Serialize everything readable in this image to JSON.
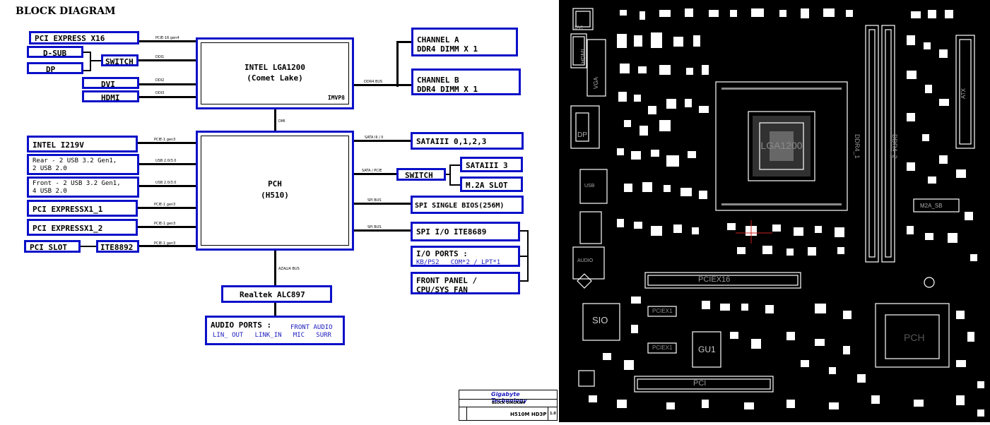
{
  "title": "BLOCK DIAGRAM",
  "cpu": {
    "line1": "INTEL LGA1200",
    "line2": "(Comet Lake)",
    "vr": "IMVP8"
  },
  "pch": {
    "line1": "PCH",
    "line2": "(H510)"
  },
  "left_top": {
    "pcie_x16": "PCI EXPRESS X16",
    "dsub": "D-SUB",
    "dp": "DP",
    "switch": "SWITCH",
    "dvi": "DVI",
    "hdmi": "HDMI"
  },
  "left_bottom": {
    "lan": "INTEL I219V",
    "rear_usb": "Rear - 2 USB 3.2 Gen1,\n2 USB 2.0",
    "front_usb": "Front - 2 USB 3.2 Gen1,\n4 USB 2.0",
    "pcie_x1_1": "PCI EXPRESSX1_1",
    "pcie_x1_2": "PCI EXPRESSX1_2",
    "pci_slot": "PCI SLOT",
    "ite8892": "ITE8892"
  },
  "right": {
    "ch_a_1": "CHANNEL A",
    "ch_a_2": "DDR4 DIMM X 1",
    "ch_b_1": "CHANNEL B",
    "ch_b_2": "DDR4 DIMM X 1",
    "sata": "SATAIII 0,1,2,3",
    "switch": "SWITCH",
    "sata3": "SATAIII 3",
    "m2a": "M.2A SLOT",
    "spi_bios": "SPI SINGLE BIOS(256M)",
    "spi_io": "SPI I/O ITE8689",
    "io_ports": "I/O PORTS :",
    "io_ports_sub": "KB/PS2   COM*2 / LPT*1",
    "front_panel_1": "FRONT PANEL /",
    "front_panel_2": "CPU/SYS FAN"
  },
  "audio": {
    "codec": "Realtek ALC897",
    "ports_label": "AUDIO PORTS :",
    "front_audio": "FRONT AUDIO",
    "line1": "LIN_ OUT   LINK_IN   MIC   SURR"
  },
  "bus_labels": {
    "pcie16": "PCIE-16 gen4",
    "ddi1": "DDI1",
    "ddi2": "DDI2",
    "ddi3": "DDI3",
    "ddr4": "DDR4 BUS",
    "dmi": "DMI",
    "lan_bus": "PCIE-1 gen3",
    "usb_rear": "USB 2.0/3.0",
    "usb_front": "USB 2.0/3.0",
    "pcie1_1": "PCIE-1 gen3",
    "pcie1_2": "PCIE-1 gen3",
    "pcie1_ite": "PCIE-1 gen3",
    "sata_bus": "SATA III / II",
    "sata_pcie": "SATA / PCIE",
    "spi1": "SPI BUS",
    "spi2": "SPI BUS",
    "azalia": "AZALIA BUS"
  },
  "title_block": {
    "company": "Gigabyte Technology",
    "name": "BLOCK DIAGRAM",
    "model": "H510M HD3P",
    "rev": "1.0"
  },
  "board": {
    "cpu_socket": "LGA1200",
    "dimm1": "DDR4_1",
    "dimm2": "DDR4_2",
    "pcie_x16_slot": "PCIEX16",
    "pci_slot": "PCI",
    "m2": "M2A_SB",
    "sio": "SIO",
    "gu1": "GU1",
    "pcie_x1_a": "PCIEX1",
    "pcie_x1_b": "PCIEX1",
    "dp": "DP",
    "hdmi": "HDMI",
    "vga": "VGA",
    "dvi": "DVI",
    "usb": "USB",
    "audio": "AUDIO",
    "atx": "ATX",
    "pch": "PCH"
  },
  "colors": {
    "block_border": "#0a10c8",
    "board_bg": "#000000",
    "board_silk": "#ffffff"
  }
}
